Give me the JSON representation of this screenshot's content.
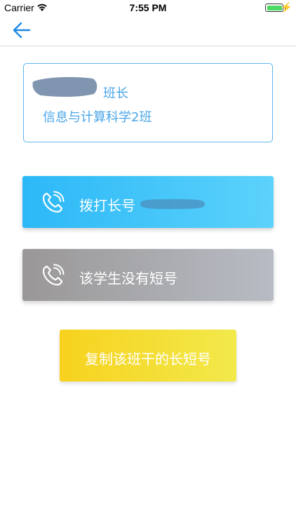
{
  "status_bar": {
    "carrier": "Carrier",
    "time": "7:55 PM",
    "battery_color": "#4cd964"
  },
  "nav": {
    "back_icon": "arrow-left-icon",
    "accent_color": "#1e88e5"
  },
  "info_card": {
    "role": "班长",
    "class_name": "信息与计算科学2班",
    "border_color": "#5fb6f3",
    "text_color": "#4aa6e8"
  },
  "call_button": {
    "label": "拨打长号",
    "icon": "phone-icon"
  },
  "no_short_button": {
    "label": "该学生没有短号",
    "icon": "phone-icon"
  },
  "copy_button": {
    "label": "复制该班干的长短号"
  }
}
